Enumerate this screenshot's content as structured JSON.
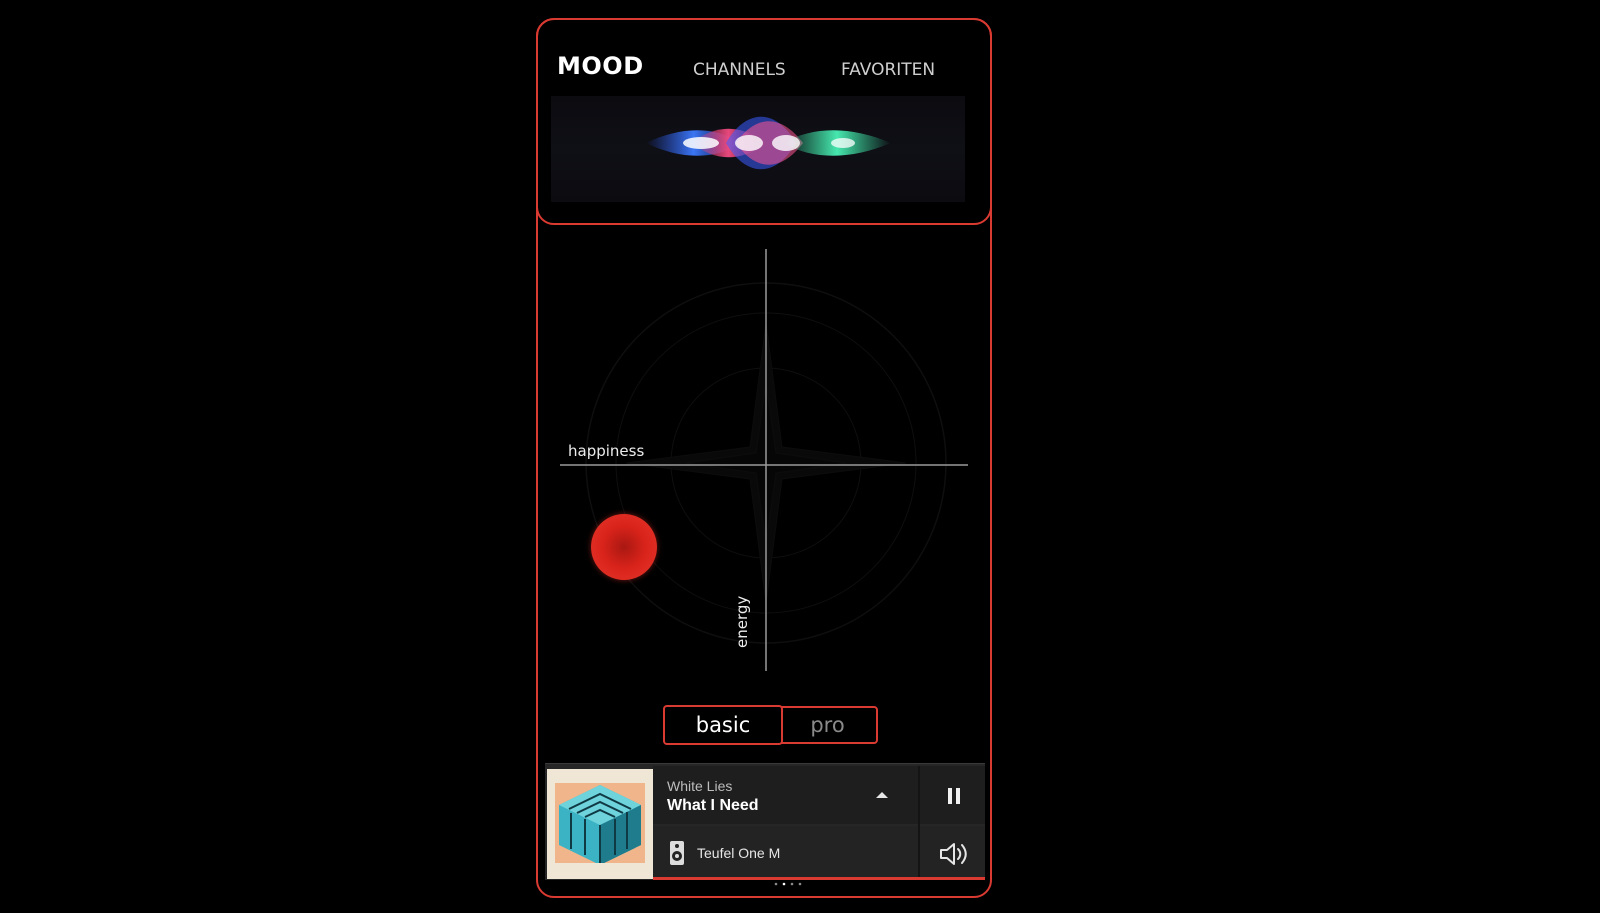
{
  "tabs": {
    "mood": "MOOD",
    "channels": "CHANNELS",
    "favoriten": "FAVORITEN"
  },
  "mood_field": {
    "x_axis_label": "happiness",
    "y_axis_label": "energy"
  },
  "mode_toggle": {
    "basic": "basic",
    "pro": "pro",
    "selected": "basic"
  },
  "player": {
    "artist": "White Lies",
    "track": "What I Need",
    "device": "Teufel One M"
  },
  "colors": {
    "accent": "#d93a32",
    "background": "#000000",
    "player_background": "#262626"
  },
  "icons": {
    "expand": "chevron-up-icon",
    "pause": "pause-icon",
    "speaker": "speaker-device-icon",
    "volume": "volume-icon"
  }
}
